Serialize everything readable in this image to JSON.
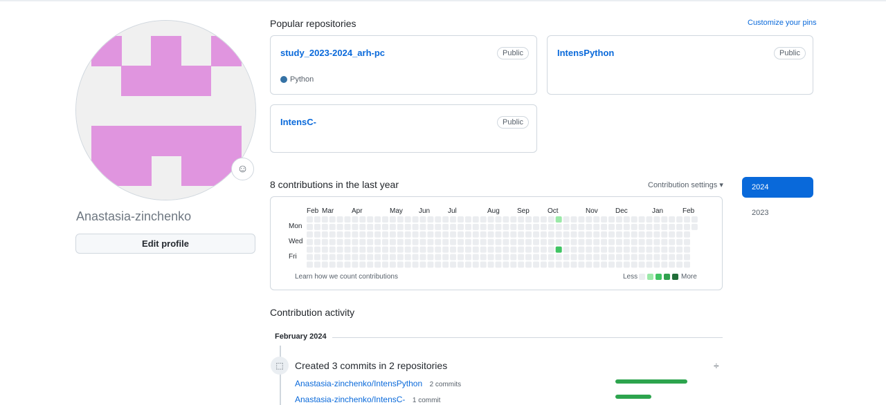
{
  "profile": {
    "username": "Anastasia-zinchenko",
    "edit_label": "Edit profile",
    "avatar_color": "#e095df",
    "emoji_icon": "smiley-icon"
  },
  "popular": {
    "title": "Popular repositories",
    "customize_label": "Customize your pins",
    "repos": [
      {
        "name": "study_2023-2024_arh-pc",
        "visibility": "Public",
        "language": "Python",
        "language_color": "#3572A5"
      },
      {
        "name": "IntensPython",
        "visibility": "Public",
        "language": ""
      },
      {
        "name": "IntensC-",
        "visibility": "Public",
        "language": ""
      }
    ]
  },
  "contributions": {
    "title": "8 contributions in the last year",
    "settings_label": "Contribution settings ▾",
    "months": [
      "Feb",
      "Mar",
      "Apr",
      "May",
      "Jun",
      "Jul",
      "Aug",
      "Sep",
      "Oct",
      "Nov",
      "Dec",
      "Jan",
      "Feb"
    ],
    "days": [
      "Mon",
      "Wed",
      "Fri"
    ],
    "learn_label": "Learn how we count contributions",
    "legend_less": "Less",
    "legend_more": "More",
    "colors": [
      "#ebedf0",
      "#9be9a8",
      "#40c463",
      "#30a14e",
      "#216e39"
    ],
    "highlights": [
      {
        "week": 33,
        "day": 0,
        "level": 1
      },
      {
        "week": 33,
        "day": 4,
        "level": 2
      },
      {
        "week": 51,
        "day": 2,
        "level": 4
      }
    ]
  },
  "years": {
    "active": "2024",
    "other": "2023"
  },
  "activity": {
    "title": "Contribution activity",
    "month": "February 2024",
    "summary": "Created 3 commits in 2 repositories",
    "items": [
      {
        "repo": "Anastasia-zinchenko/IntensPython",
        "count": "2 commits",
        "share": 1.0
      },
      {
        "repo": "Anastasia-zinchenko/IntensC-",
        "count": "1 commit",
        "share": 0.5
      }
    ]
  }
}
